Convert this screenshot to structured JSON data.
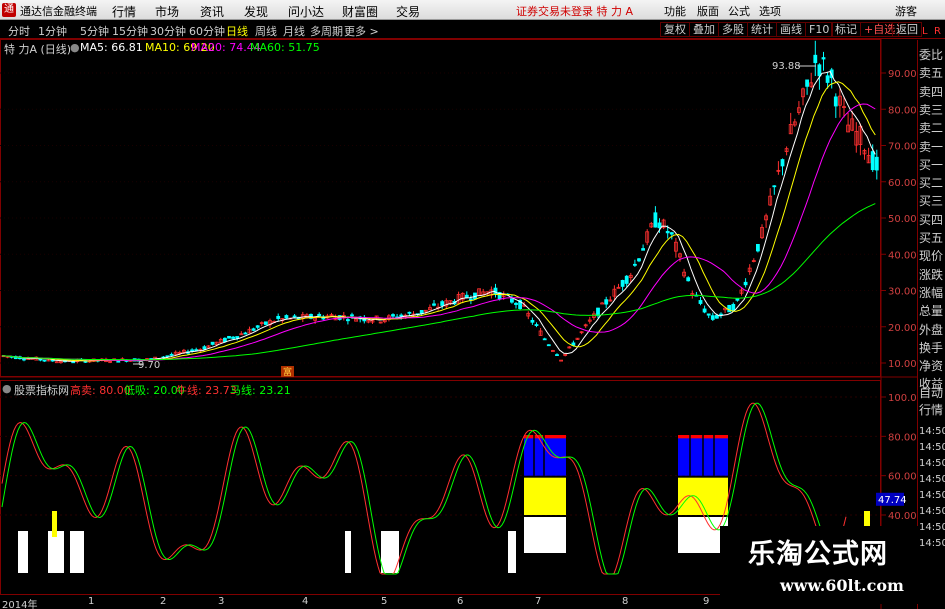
{
  "app": {
    "title": "通达信金融终端",
    "logo_char": "通",
    "menus": [
      "行情",
      "市场",
      "资讯",
      "发现",
      "问小达",
      "财富圈",
      "交易"
    ],
    "status": "证券交易未登录  特 力 A",
    "right_menus": [
      "功能",
      "版面",
      "公式",
      "选项",
      "游客"
    ]
  },
  "toolbar": {
    "periods": [
      "分时",
      "1分钟",
      "5分钟",
      "15分钟",
      "30分钟",
      "60分钟",
      "日线",
      "周线",
      "月线",
      "多周期",
      "更多 >"
    ],
    "active_period": "日线",
    "tools": [
      "复权",
      "叠加",
      "多股",
      "统计",
      "画线",
      "F10",
      "标记",
      "+自选",
      "返回"
    ]
  },
  "main_chart": {
    "stock_label": "特 力A (日线)",
    "ma": [
      {
        "label": "MA5: 66.81",
        "color": "#ffffff"
      },
      {
        "label": "MA10: 69.20",
        "color": "#ffff00"
      },
      {
        "label": "MA20: 74.44",
        "color": "#ff00ff"
      },
      {
        "label": "MA60: 51.75",
        "color": "#00ff00"
      }
    ],
    "y_ticks": [
      "90.00",
      "80.00",
      "70.00",
      "60.00",
      "50.00",
      "40.00",
      "30.00",
      "20.00",
      "10.00"
    ],
    "high_marker": "93.88",
    "low_marker": "9.70",
    "event_marker": "富"
  },
  "indicator": {
    "name": "股票指标网",
    "params": [
      {
        "label": "高卖: 80.00",
        "color": "#ff3030"
      },
      {
        "label": "低吸: 20.00",
        "color": "#00ff00"
      },
      {
        "label": "牛线: 23.73",
        "color": "#ff3030"
      },
      {
        "label": "马线: 23.21",
        "color": "#00ff00"
      }
    ],
    "y_ticks": [
      "100.0",
      "80.00",
      "60.00",
      "40.00"
    ],
    "current_value": "47.74"
  },
  "sidepanel": {
    "lr": [
      "L",
      "R"
    ],
    "labels": [
      "委比",
      "卖五",
      "卖四",
      "卖三",
      "卖二",
      "卖一",
      "买一",
      "买二",
      "买三",
      "买四",
      "买五",
      "现价",
      "涨跌",
      "涨幅",
      "总量",
      "外盘",
      "换手",
      "净资",
      "收益"
    ],
    "tail": [
      "自动",
      "行情"
    ],
    "times": [
      "14:50",
      "14:50",
      "14:50",
      "14:50",
      "14:50",
      "14:50",
      "14:50",
      "14:50"
    ]
  },
  "date_axis": [
    "2014年",
    "1",
    "2",
    "3",
    "4",
    "5",
    "6",
    "7",
    "8",
    "9"
  ],
  "watermark": {
    "line1": "乐淘公式网",
    "line2": "www.60lt.com"
  },
  "colors": {
    "up": "#ff3030",
    "down": "#00ffff",
    "frame": "#800000"
  }
}
